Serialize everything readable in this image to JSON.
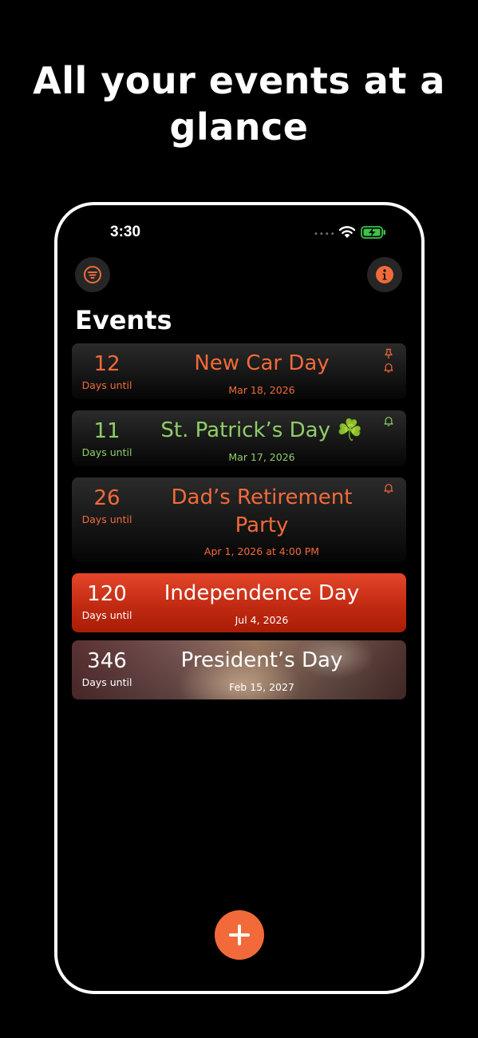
{
  "headline": "All your events at a glance",
  "status": {
    "time": "3:30"
  },
  "page": {
    "title": "Events"
  },
  "colors": {
    "accent": "#f26a3a",
    "green": "#8fce69",
    "red": "#c22a12"
  },
  "events": [
    {
      "count": "12",
      "count_label": "Days until",
      "name": "New Car Day",
      "date": "Mar 18, 2026",
      "icons": [
        "pin-icon",
        "bell-icon"
      ]
    },
    {
      "count": "11",
      "count_label": "Days until",
      "name": "St. Patrick’s Day ☘️",
      "date": "Mar 17, 2026",
      "icons": [
        "bell-icon"
      ]
    },
    {
      "count": "26",
      "count_label": "Days until",
      "name": "Dad’s Retirement Party",
      "date": "Apr 1, 2026 at 4:00 PM",
      "icons": [
        "bell-icon"
      ]
    },
    {
      "count": "120",
      "count_label": "Days until",
      "name": "Independence Day",
      "date": "Jul 4, 2026"
    },
    {
      "count": "346",
      "count_label": "Days until",
      "name": "President’s Day",
      "date": "Feb 15, 2027"
    }
  ]
}
